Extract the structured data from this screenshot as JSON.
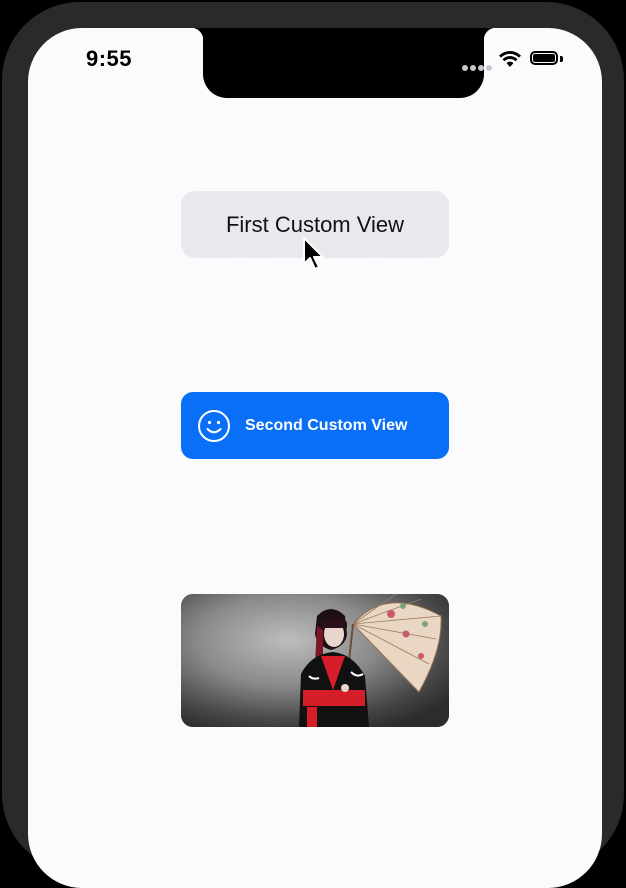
{
  "status_bar": {
    "time": "9:55",
    "icons": [
      "cellular-dots-icon",
      "wifi-icon",
      "battery-icon"
    ]
  },
  "first_custom_view": {
    "label": "First Custom View",
    "background": "#ebebf0"
  },
  "second_custom_view": {
    "label": "Second Custom View",
    "icon": "smiley-face-icon",
    "background": "#0a6ff7"
  },
  "image_view": {
    "content": "photo of a woman in a black and red kimono holding a paper parasol"
  }
}
